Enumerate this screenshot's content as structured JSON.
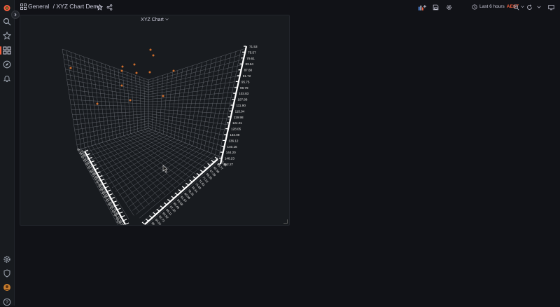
{
  "breadcrumb": {
    "folder": "General",
    "separator": "/",
    "dashboard": "XYZ Chart Demo"
  },
  "time_picker": {
    "label": "Last 6 hours",
    "timezone": "AEST"
  },
  "panel": {
    "title": "XYZ Chart"
  },
  "sidebar": {
    "items": [
      "grafana-logo-icon",
      "search-icon",
      "star-icon",
      "dashboards-icon",
      "explore-icon",
      "alerting-icon",
      "configuration-icon",
      "shield-icon",
      "avatar",
      "help-icon"
    ]
  },
  "colors": {
    "background": "#111217",
    "panel": "#181b1f",
    "accent": "#f55f3e",
    "point": "#e0752d"
  },
  "chart_data": {
    "type": "scatter",
    "title": "XYZ Chart",
    "axis_right_ticks": [
      "71.53",
      "75.57",
      "79.61",
      "83.64",
      "87.68",
      "91.72",
      "95.75",
      "99.79",
      "103.83",
      "107.86",
      "111.90",
      "115.94",
      "119.98",
      "124.01",
      "128.05",
      "132.09",
      "136.12",
      "140.16",
      "144.20",
      "148.23",
      "152.27"
    ],
    "axis_bottom_left_ticks": [
      "100.55",
      "98.36",
      "96.17",
      "93.98",
      "91.79",
      "89.60",
      "87.41",
      "85.22",
      "83.03",
      "80.84",
      "78.65",
      "76.46",
      "74.27",
      "72.08",
      "69.89",
      "67.70",
      "65.51",
      "63.32",
      "61.13",
      "58.94",
      "56.75"
    ],
    "axis_bottom_right_ticks": [
      "98.16",
      "96.35",
      "94.54",
      "92.73",
      "90.92",
      "89.11",
      "87.30",
      "85.49",
      "83.68",
      "81.87",
      "80.06",
      "78.25",
      "76.44",
      "74.63",
      "72.82",
      "71.01",
      "69.20",
      "67.39",
      "65.58",
      "63.77",
      "61.96"
    ]
  }
}
